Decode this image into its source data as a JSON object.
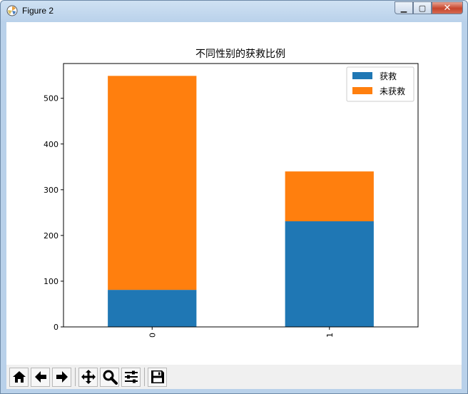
{
  "window": {
    "title": "Figure 2",
    "minimize_glyph": "▁",
    "maximize_glyph": "▢",
    "close_glyph": "✕"
  },
  "toolbar": {
    "buttons": [
      {
        "name": "home-icon"
      },
      {
        "name": "back-arrow-icon"
      },
      {
        "name": "forward-arrow-icon"
      },
      {
        "name": "pan-icon"
      },
      {
        "name": "zoom-icon"
      },
      {
        "name": "configure-subplots-icon"
      },
      {
        "name": "save-icon"
      }
    ]
  },
  "chart_data": {
    "type": "bar",
    "stacked": true,
    "title": "不同性别的获救比例",
    "xlabel": "",
    "ylabel": "",
    "categories": [
      "0",
      "1"
    ],
    "series": [
      {
        "name": "获救",
        "values": [
          81,
          231
        ],
        "color": "#1f77b4"
      },
      {
        "name": "未获救",
        "values": [
          468,
          109
        ],
        "color": "#ff7f0e"
      }
    ],
    "yticks": [
      0,
      100,
      200,
      300,
      400,
      500
    ],
    "ylim": [
      0,
      576
    ],
    "grid": false,
    "legend_position": "top-right"
  }
}
